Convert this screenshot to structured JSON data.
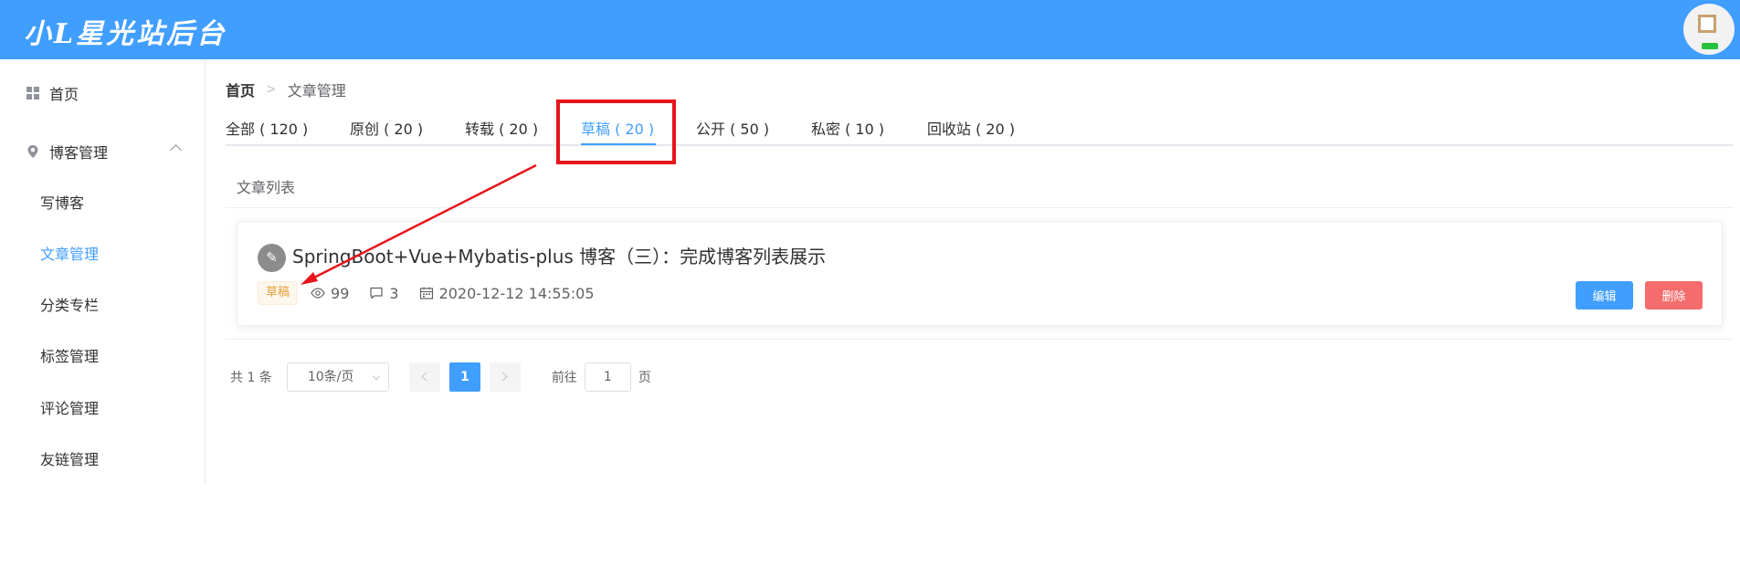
{
  "header": {
    "logo_text": "小L星光站后台",
    "avatar_icon": "avatar-image"
  },
  "sidebar": {
    "home": {
      "label": "首页",
      "icon": "grid-icon"
    },
    "blog_group": {
      "label": "博客管理",
      "icon": "location-pin-icon",
      "expanded": true
    },
    "items": [
      {
        "label": "写博客",
        "active": false
      },
      {
        "label": "文章管理",
        "active": true
      },
      {
        "label": "分类专栏",
        "active": false
      },
      {
        "label": "标签管理",
        "active": false
      },
      {
        "label": "评论管理",
        "active": false
      },
      {
        "label": "友链管理",
        "active": false
      }
    ]
  },
  "breadcrumb": {
    "home": "首页",
    "current": "文章管理"
  },
  "tabs": [
    {
      "label": "全部 ( 120 )",
      "active": false
    },
    {
      "label": "原创 ( 20 )",
      "active": false
    },
    {
      "label": "转载 ( 20 )",
      "active": false
    },
    {
      "label": "草稿 ( 20 )",
      "active": true
    },
    {
      "label": "公开 ( 50 )",
      "active": false
    },
    {
      "label": "私密 ( 10 )",
      "active": false
    },
    {
      "label": "回收站 ( 20 )",
      "active": false
    }
  ],
  "section_title": "文章列表",
  "articles": [
    {
      "title": "SpringBoot+Vue+Mybatis-plus 博客（三）：完成博客列表展示",
      "tag": "草稿",
      "views": "99",
      "comments": "3",
      "date": "2020-12-12 14:55:05",
      "edit_label": "编辑",
      "delete_label": "删除"
    }
  ],
  "pagination": {
    "total": "共 1 条",
    "page_size": "10条/页",
    "current_page": "1",
    "goto_label": "前往",
    "goto_value": "1",
    "page_suffix": "页"
  },
  "colors": {
    "primary": "#409eff",
    "danger": "#f56c6c",
    "warning": "#e6a23c",
    "annotation": "#e8141b"
  }
}
